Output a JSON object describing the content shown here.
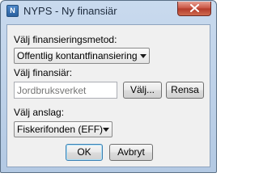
{
  "window": {
    "title": "NYPS - Ny finansiär",
    "icon": "app-icon",
    "icon_glyph": "N",
    "close_icon": "close-icon"
  },
  "method": {
    "label": "Välj finansieringsmetod:",
    "selected": "Offentlig kontantfinansiering"
  },
  "financier": {
    "label": "Välj finansiär:",
    "placeholder": "Jordbruksverket",
    "choose_label": "Välj...",
    "clear_label": "Rensa"
  },
  "grant": {
    "label": "Välj anslag:",
    "selected": "Fiskerifonden (EFF)"
  },
  "actions": {
    "ok_label": "OK",
    "cancel_label": "Avbryt"
  },
  "colors": {
    "title_close": "#c75140",
    "default_button_border": "#3c7fb1"
  }
}
